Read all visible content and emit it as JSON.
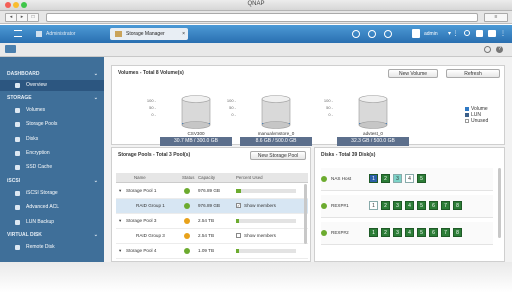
{
  "window": {
    "title": "QNAP"
  },
  "app_tabs": [
    {
      "label": "Administrator"
    },
    {
      "label": "Storage Manager"
    }
  ],
  "header": {
    "user": "admin"
  },
  "sidebar": {
    "sections": [
      {
        "label": "DASHBOARD",
        "items": [
          {
            "label": "Overview"
          }
        ]
      },
      {
        "label": "STORAGE",
        "items": [
          {
            "label": "Volumes"
          },
          {
            "label": "Storage Pools"
          },
          {
            "label": "Disks"
          },
          {
            "label": "Encryption"
          },
          {
            "label": "SSD Cache"
          }
        ]
      },
      {
        "label": "iSCSI",
        "items": [
          {
            "label": "iSCSI Storage"
          },
          {
            "label": "Advanced ACL"
          },
          {
            "label": "LUN Backup"
          }
        ]
      },
      {
        "label": "VIRTUAL DISK",
        "items": [
          {
            "label": "Remote Disk"
          }
        ]
      }
    ]
  },
  "volumes": {
    "title": "Volumes - Total 8 Volume(s)",
    "new_button": "New Volume",
    "refresh_button": "Refresh",
    "ticks": [
      "100 -",
      "50 -",
      "0 -"
    ],
    "items": [
      {
        "name": "CSV300",
        "usage": "30.7 MB / 300.0 GB",
        "fill": 0.05
      },
      {
        "name": "manualvmstore_0",
        "usage": "8.6 GB / 500.0 GB",
        "fill": 0.05
      },
      {
        "name": "advtest_0",
        "usage": "32.3 GB / 500.0 GB",
        "fill": 0.1
      }
    ],
    "legend": [
      {
        "label": "Volume",
        "color": "#2f79c4"
      },
      {
        "label": "LUN",
        "color": "#3a5f8a"
      },
      {
        "label": "Unused",
        "color": "#ffffff"
      }
    ]
  },
  "storage_pools": {
    "title": "Storage Pools - Total 3 Pool(s)",
    "new_button": "New Storage Pool",
    "columns": [
      "Name",
      "Status",
      "Capacity",
      "Percent Used"
    ],
    "rows": [
      {
        "name": "Storage Pool 1",
        "status": "ok",
        "capacity": "976.89 GB",
        "percent": 0.08,
        "type": "pool"
      },
      {
        "name": "RAID Group 1",
        "status": "ok",
        "capacity": "976.89 GB",
        "show": "Show members",
        "checked": true,
        "type": "raid"
      },
      {
        "name": "Storage Pool 3",
        "status": "warn",
        "capacity": "2.54 TB",
        "percent": 0.05,
        "type": "pool"
      },
      {
        "name": "RAID Group 3",
        "status": "warn",
        "capacity": "2.54 TB",
        "show": "Show members",
        "checked": false,
        "type": "raid"
      },
      {
        "name": "Storage Pool 4",
        "status": "ok",
        "capacity": "1.09 TB",
        "percent": 0.05,
        "type": "pool"
      }
    ]
  },
  "disks": {
    "title": "Disks - Total 39 Disk(s)",
    "shelves": [
      {
        "name": "NAS Host",
        "disks": [
          "1",
          "2",
          "3",
          "4",
          "5"
        ],
        "colors": [
          "#2c5fa8",
          "#2c7d37",
          "#7dd3c8",
          "#ffffff",
          "#2c7d37"
        ]
      },
      {
        "name": "REXP#1",
        "disks": [
          "1",
          "2",
          "3",
          "4",
          "5",
          "6",
          "7",
          "8"
        ],
        "colors": [
          "#ffffff",
          "#2c7d37",
          "#2c7d37",
          "#2c7d37",
          "#2c7d37",
          "#2c7d37",
          "#2c7d37",
          "#2c7d37"
        ]
      },
      {
        "name": "REXP#2",
        "disks": [
          "1",
          "2",
          "3",
          "4",
          "5",
          "6",
          "7",
          "8"
        ],
        "colors": [
          "#2c7d37",
          "#2c7d37",
          "#2c7d37",
          "#2c7d37",
          "#2c7d37",
          "#2c7d37",
          "#2c7d37",
          "#2c7d37"
        ]
      }
    ]
  }
}
